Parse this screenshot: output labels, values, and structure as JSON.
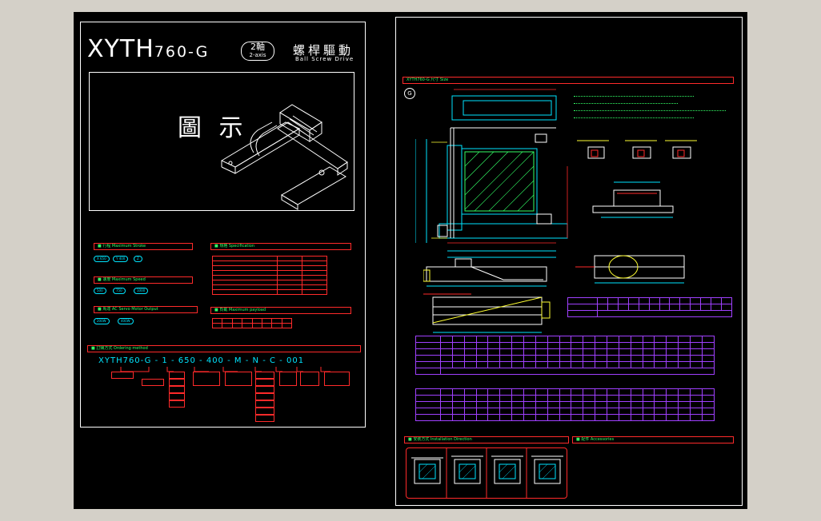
{
  "left": {
    "model": "XYTH",
    "model_suffix": "760-G",
    "axis_cn": "2軸",
    "axis_en": "2-axis",
    "drive_cn": "螺桿驅動",
    "drive_en": "Ball Screw Drive",
    "figure_label": "圖 示",
    "order_code": [
      "XYTH760-G",
      "1",
      "650",
      "400",
      "M",
      "N",
      "C",
      "001"
    ],
    "order_code_seps": [
      "-",
      "-",
      "-",
      "-",
      "-",
      "-",
      "-"
    ]
  },
  "right": {
    "detail_marker": "G"
  },
  "colors": {
    "background": "#000000",
    "frame": "#ffffff",
    "section": "#ff2a2a",
    "text": "#33ff66",
    "dimension": "#00e5ff",
    "table": "#a040ff"
  }
}
